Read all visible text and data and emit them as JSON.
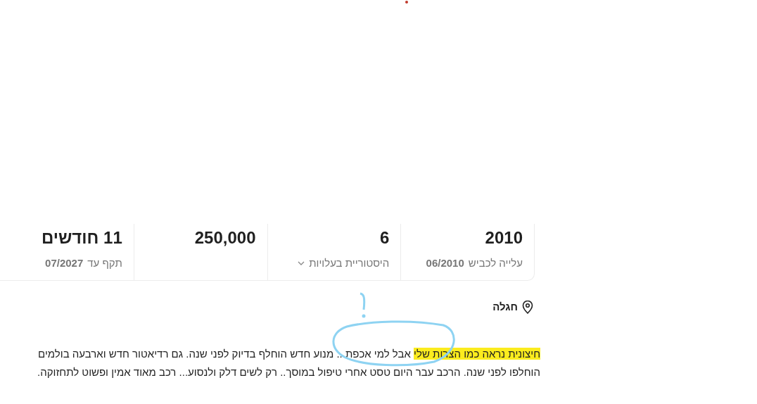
{
  "stats": [
    {
      "kind": "text",
      "value": "2010",
      "caption": "עלייה לכביש **06/2010**"
    },
    {
      "kind": "dropdown",
      "value": "6",
      "caption": "היסטוריית בעלויות"
    },
    {
      "kind": "text",
      "value": "250,000"
    },
    {
      "kind": "text",
      "value": "11 חודשים",
      "caption": "תקף עד **07/2027**"
    }
  ],
  "location": "חגלה",
  "description": {
    "highlighted": "חיצונית נראה כמו הצרות שלי",
    "text": "אבל למי אכפת... מנוע חדש הוחלף בדיוק לפני שנה. גם רדיאטור חדש וארבעה בולמים הוחלפו לפני שנה. הרכב עבר היום טסט אחרי טיפול במוסך.. רק לשים דלק ולנסוע... רכב מאוד אמין ופשוט לתחזוקה."
  }
}
